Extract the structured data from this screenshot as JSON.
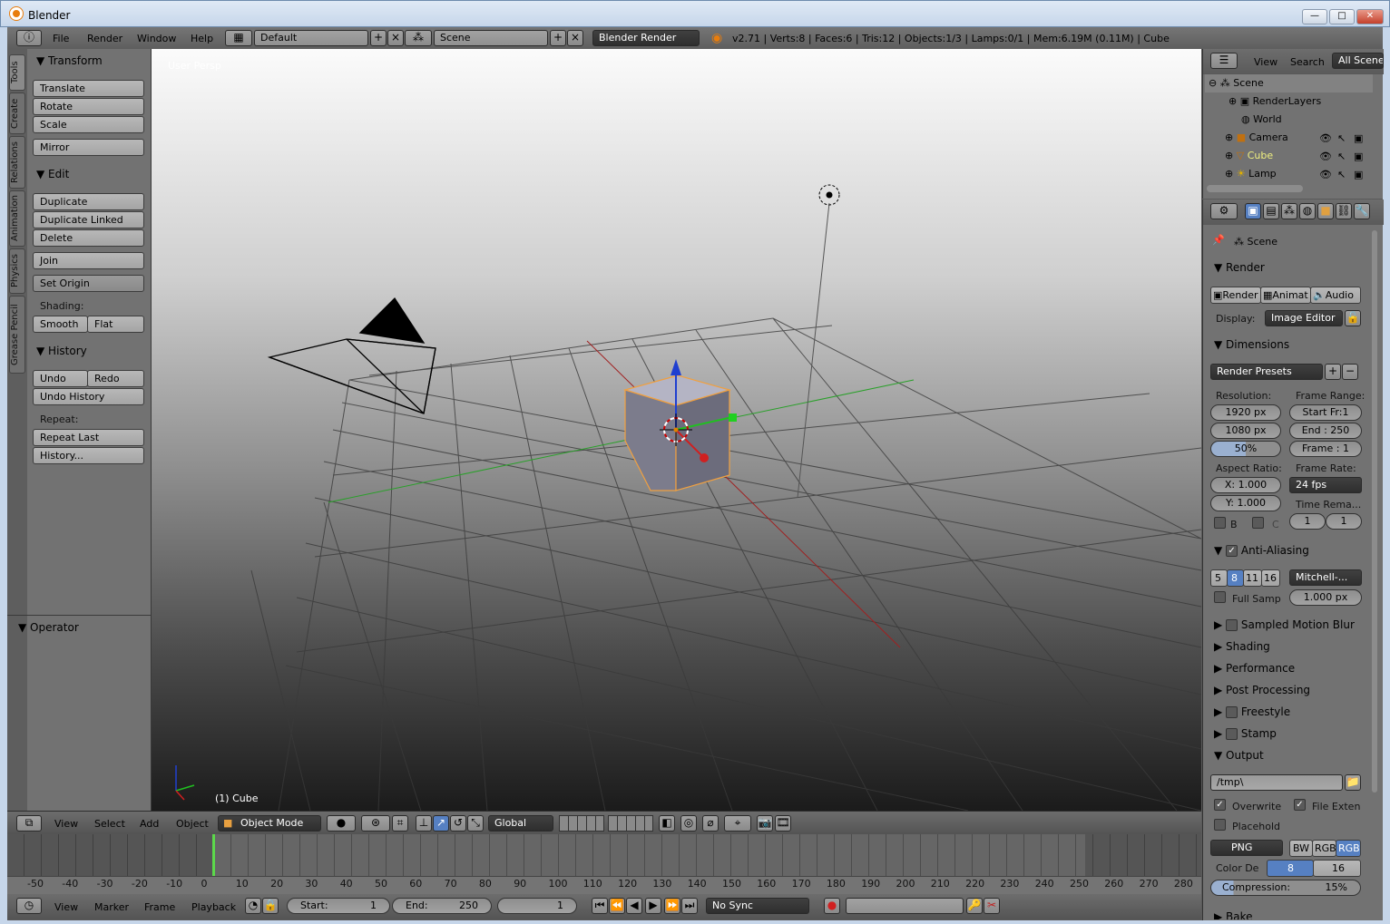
{
  "window": {
    "title": "Blender",
    "min": "—",
    "max": "□",
    "close": "✕"
  },
  "menubar": {
    "items": [
      "File",
      "Render",
      "Window",
      "Help"
    ],
    "layout": "Default",
    "scene": "Scene",
    "engine": "Blender Render",
    "stats": "v2.71 | Verts:8 | Faces:6 | Tris:12 | Objects:1/3 | Lamps:0/1 | Mem:6.19M (0.11M) | Cube"
  },
  "tool_tabs": [
    "Tools",
    "Create",
    "Relations",
    "Animation",
    "Physics",
    "Grease Pencil"
  ],
  "tools": {
    "transform_title": "Transform",
    "translate": "Translate",
    "rotate": "Rotate",
    "scale": "Scale",
    "mirror": "Mirror",
    "edit_title": "Edit",
    "duplicate": "Duplicate",
    "duplicate_linked": "Duplicate Linked",
    "delete": "Delete",
    "join": "Join",
    "set_origin": "Set Origin",
    "shading_label": "Shading:",
    "smooth": "Smooth",
    "flat": "Flat",
    "history_title": "History",
    "undo": "Undo",
    "redo": "Redo",
    "undo_history": "Undo History",
    "repeat_label": "Repeat:",
    "repeat_last": "Repeat Last",
    "history": "History...",
    "operator_title": "Operator"
  },
  "viewport": {
    "view_label": "User Persp",
    "object_label": "(1) Cube"
  },
  "view3d_header": {
    "view": "View",
    "select": "Select",
    "add": "Add",
    "object": "Object",
    "mode": "Object Mode",
    "orientation": "Global"
  },
  "timeline": {
    "ticks": [
      "-50",
      "-40",
      "-30",
      "-20",
      "-10",
      "0",
      "10",
      "20",
      "30",
      "40",
      "50",
      "60",
      "70",
      "80",
      "90",
      "100",
      "110",
      "120",
      "130",
      "140",
      "150",
      "160",
      "170",
      "180",
      "190",
      "200",
      "210",
      "220",
      "230",
      "240",
      "250",
      "260",
      "270",
      "280"
    ],
    "view": "View",
    "marker": "Marker",
    "frame": "Frame",
    "playback": "Playback",
    "start_label": "Start:",
    "start": "1",
    "end_label": "End:",
    "end": "250",
    "current": "1",
    "sync": "No Sync"
  },
  "outliner": {
    "view": "View",
    "search": "Search",
    "filter": "All Scenes",
    "items": [
      "Scene",
      "RenderLayers",
      "World",
      "Camera",
      "Cube",
      "Lamp"
    ]
  },
  "properties": {
    "context": "Scene",
    "render_title": "Render",
    "render_btn": "Render",
    "anim_btn": "Animat",
    "audio_btn": "Audio",
    "display_label": "Display:",
    "display": "Image Editor",
    "dimensions_title": "Dimensions",
    "presets": "Render Presets",
    "resolution_label": "Resolution:",
    "res_x": "1920 px",
    "res_y": "1080 px",
    "res_pct": "50%",
    "frame_range_label": "Frame Range:",
    "start_fr": "Start Fr:1",
    "end_fr": "End : 250",
    "frame": "Frame : 1",
    "aspect_label": "Aspect Ratio:",
    "aspect_x": "X:  1.000",
    "aspect_y": "Y:  1.000",
    "frame_rate_label": "Frame Rate:",
    "fps": "24 fps",
    "time_remap": "Time Rema...",
    "remap_a": "1",
    "remap_b": "1",
    "b": "B",
    "c": "C",
    "aa_title": "Anti-Aliasing",
    "aa_samples": [
      "5",
      "8",
      "11",
      "16"
    ],
    "aa_filter": "Mitchell-...",
    "full_sample": "Full Samp",
    "filter_size": "1.000 px",
    "collapsed": [
      "Sampled Motion Blur",
      "Shading",
      "Performance",
      "Post Processing",
      "Freestyle",
      "Stamp"
    ],
    "output_title": "Output",
    "output_path": "/tmp\\",
    "overwrite": "Overwrite",
    "file_ext": "File Exten",
    "placeholders": "Placehold",
    "format": "PNG",
    "bw": "BW",
    "rgb": "RGB",
    "rgba": "RGB",
    "color_depth_label": "Color De",
    "depth8": "8",
    "depth16": "16",
    "compression": "Compression:",
    "compression_val": "15%",
    "bake": "Bake"
  }
}
